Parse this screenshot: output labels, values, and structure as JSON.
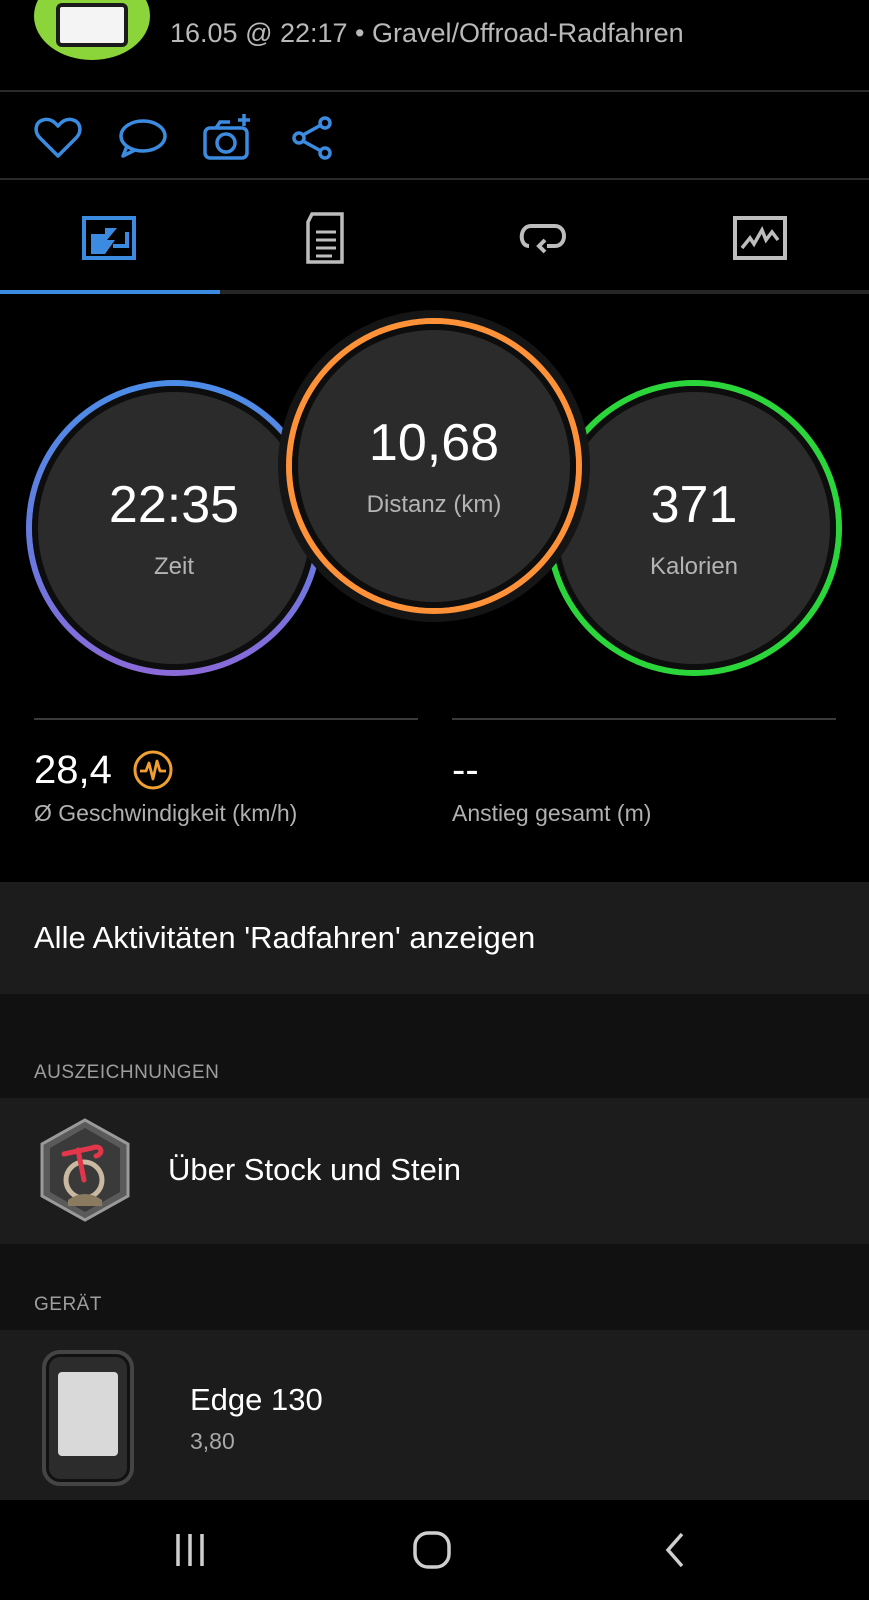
{
  "header": {
    "subtitle": "16.05 @ 22:17 • Gravel/Offroad-Radfahren",
    "badge_icon": "activity-badge-icon"
  },
  "actions": [
    {
      "icon": "heart-icon"
    },
    {
      "icon": "comment-icon"
    },
    {
      "icon": "add-photo-icon"
    },
    {
      "icon": "share-icon"
    }
  ],
  "tabs": [
    {
      "icon": "summary-tab-icon",
      "active": true
    },
    {
      "icon": "details-tab-icon"
    },
    {
      "icon": "laps-tab-icon"
    },
    {
      "icon": "charts-tab-icon"
    }
  ],
  "circles": {
    "time": {
      "value": "22:35",
      "label": "Zeit",
      "color": "#5b84e6"
    },
    "distance": {
      "value": "10,68",
      "label": "Distanz (km)",
      "color": "#ff9238"
    },
    "calories": {
      "value": "371",
      "label": "Kalorien",
      "color": "#2bd63a"
    }
  },
  "stats": {
    "speed": {
      "value": "28,4",
      "label": "Ø Geschwindigkeit (km/h)"
    },
    "ascent": {
      "value": "--",
      "label": "Anstieg gesamt (m)"
    }
  },
  "view_all": "Alle Aktivitäten 'Radfahren' anzeigen",
  "awards": {
    "section_label": "AUSZEICHNUNGEN",
    "title": "Über Stock und Stein"
  },
  "device": {
    "section_label": "GERÄT",
    "name": "Edge 130",
    "version": "3,80"
  },
  "accent_color": "#3b8be0"
}
